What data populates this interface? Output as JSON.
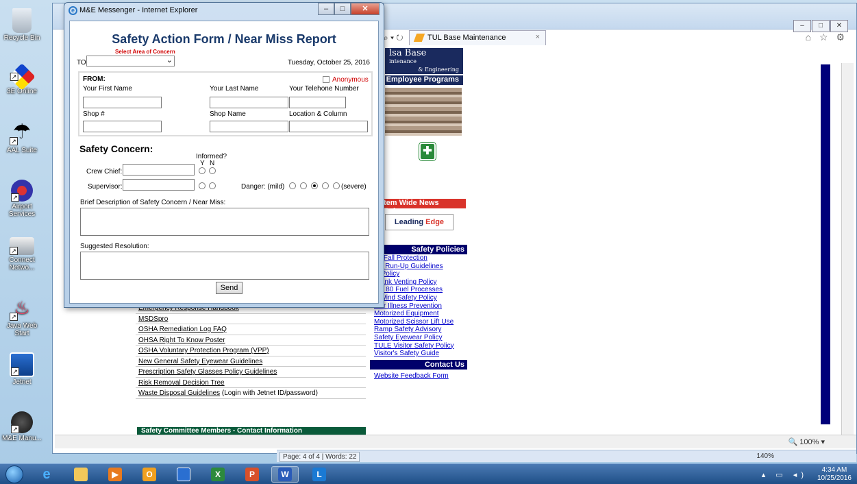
{
  "desktop": {
    "icons": [
      {
        "label": "Recycle Bin",
        "name": "recycle-bin-icon"
      },
      {
        "label": "3E Online",
        "name": "3e-online-icon"
      },
      {
        "label": "AAL Suite",
        "name": "aal-suite-icon"
      },
      {
        "label": "Airport Services",
        "name": "airport-services-icon"
      },
      {
        "label": "Connect Netwo...",
        "name": "connect-network-icon"
      },
      {
        "label": "Java Web Start",
        "name": "java-web-start-icon"
      },
      {
        "label": "Jetnet",
        "name": "jetnet-icon"
      },
      {
        "label": "M&E Manu...",
        "name": "me-manual-icon"
      }
    ]
  },
  "browser": {
    "tab_title": "TUL Base Maintenance",
    "tab_close": "×",
    "search_glyph": "⌕ ▾ ↻",
    "favorites_glyphs": "⌂ ☆ ⚙",
    "status_zoom": "100%",
    "window_minimize": "–",
    "window_maximize": "□",
    "window_close": "✕"
  },
  "page": {
    "logo_line1": "lsa Base",
    "logo_line2": "intenance",
    "logo_line3": "& Engineering",
    "employee_programs": "Employee Programs",
    "news_release": "tem Wide News Release",
    "leading_edge_1": "Leading ",
    "leading_edge_2": "Edge",
    "safety_policies_header": "Safety Policies",
    "safety_policies": [
      "ne Fall Protection",
      "ine Run-Up Guidelines",
      "O Policy",
      "l Tank Venting Policy",
      "gar 80 Fuel Processes",
      "h Wind Safety Policy",
      "mer Illness Prevention",
      "Motorized Equipment",
      "Motorized Scissor Lift Use",
      "Ramp Safety Advisory",
      "Safety Eyewear Policy",
      "TULE Visitor Safety Policy",
      "Visitor's Safety Guide"
    ],
    "contact_header": "Contact Us",
    "contact_link": "Website Feedback Form",
    "mid_list": [
      "Emergency Response Handbook",
      "MSDSpro",
      "OSHA Remediation Log FAQ",
      "OHSA Right To Know Poster",
      "OSHA Voluntary Protection Program (VPP)",
      "New General Safety Eyewear Guidelines",
      "Prescription Safety Glasses Policy Guidelines",
      "Risk Removal Decision Tree",
      "Waste Disposal Guidelines"
    ],
    "waste_suffix": " (Login with Jetnet ID/password)",
    "committee": "Safety Committee Members - Contact Information"
  },
  "word_status": {
    "page": "Page: 4 of 4",
    "words": "Words: 22",
    "zoom": "140%"
  },
  "popup": {
    "window_title": "M&E Messenger - Internet Explorer",
    "form_title": "Safety Action Form / Near Miss Report",
    "area_hint": "Select Area of Concern",
    "to_label": "TO:",
    "to_value": "",
    "date": "Tuesday, October 25, 2016",
    "from_label": "FROM:",
    "anonymous_label": "Anonymous",
    "anonymous_checked": false,
    "first_name_label": "Your First Name",
    "last_name_label": "Your Last Name",
    "phone_label": "Your Telehone Number",
    "shop_num_label": "Shop #",
    "shop_name_label": "Shop Name",
    "location_label": "Location & Column",
    "concern_heading": "Safety Concern:",
    "informed_label": "Informed?",
    "y_label": "Y",
    "n_label": "N",
    "crew_chief_label": "Crew Chief:",
    "supervisor_label": "Supervisor:",
    "danger_label": "Danger: (mild)",
    "danger_severe": "(severe)",
    "danger_selected_index": 2,
    "description_label": "Brief Description of Safety Concern / Near Miss:",
    "resolution_label": "Suggested Resolution:",
    "send_label": "Send"
  },
  "taskbar": {
    "time": "4:34 AM",
    "date": "10/25/2016"
  },
  "colors": {
    "form_title": "#1a3a6b",
    "hint_red": "#d00000",
    "navy": "#00006b",
    "news_red": "#d9342b",
    "committee_green": "#0a5a3a"
  }
}
